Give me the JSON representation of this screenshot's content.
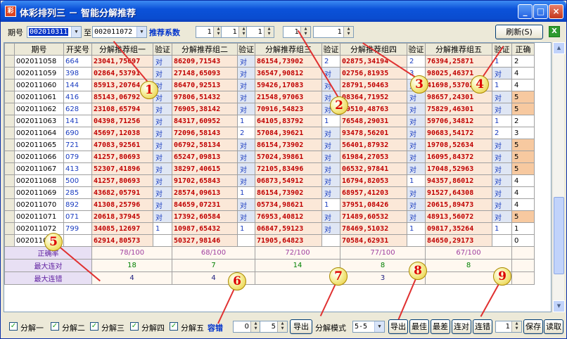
{
  "window": {
    "title": "体彩排列三 － 智能分解推荐",
    "icon": "pl3-app-icon",
    "buttons": [
      "minimize-icon",
      "maximize-icon",
      "close-icon"
    ]
  },
  "toolbar": {
    "period_label": "期号",
    "from_value": "002010311",
    "to_label": "至",
    "to_value": "002011072",
    "coef_label": "推荐系数",
    "coef_values": [
      "1",
      "1",
      "1",
      "1",
      "1"
    ],
    "refresh_label": "刷新(S)"
  },
  "table": {
    "headers": [
      "期号",
      "开奖号",
      "分解推荐组一",
      "验证",
      "分解推荐组二",
      "验证",
      "分解推荐组三",
      "验证",
      "分解推荐组四",
      "验证",
      "分解推荐组五",
      "验证",
      "正确"
    ],
    "rows": [
      [
        "002011058",
        "664",
        "23041,75697",
        "对",
        "86209,71543",
        "对",
        "86154,73902",
        "2",
        "02875,34194",
        "2",
        "76394,25871",
        "1",
        "2"
      ],
      [
        "002011059",
        "398",
        "02864,53791",
        "对",
        "27148,65093",
        "对",
        "36547,90812",
        "对",
        "02756,81935",
        "3",
        "98025,46371",
        "对",
        "4"
      ],
      [
        "002011060",
        "144",
        "85913,20764",
        "对",
        "86470,92513",
        "对",
        "59426,17083",
        "对",
        "28791,50463",
        "对",
        "41698,53702",
        "1",
        "4"
      ],
      [
        "002011061",
        "416",
        "85143,06792",
        "对",
        "97806,51432",
        "对",
        "21548,97063",
        "对",
        "08364,71952",
        "对",
        "98657,24301",
        "对",
        "5"
      ],
      [
        "002011062",
        "628",
        "23108,65794",
        "对",
        "76905,38142",
        "对",
        "70916,54823",
        "对",
        "29510,48763",
        "对",
        "75829,46301",
        "对",
        "5"
      ],
      [
        "002011063",
        "141",
        "04398,71256",
        "对",
        "84317,60952",
        "1",
        "64105,83792",
        "1",
        "76548,29031",
        "对",
        "59706,34812",
        "1",
        "2"
      ],
      [
        "002011064",
        "690",
        "45697,12038",
        "对",
        "72096,58143",
        "2",
        "57084,39621",
        "对",
        "93478,56201",
        "对",
        "90683,54172",
        "2",
        "3"
      ],
      [
        "002011065",
        "721",
        "47083,92561",
        "对",
        "06792,58134",
        "对",
        "86154,73902",
        "对",
        "56401,87932",
        "对",
        "19708,52634",
        "对",
        "5"
      ],
      [
        "002011066",
        "079",
        "41257,80693",
        "对",
        "65247,09813",
        "对",
        "57024,39861",
        "对",
        "61984,27053",
        "对",
        "16095,84372",
        "对",
        "5"
      ],
      [
        "002011067",
        "413",
        "52307,41896",
        "对",
        "38297,40615",
        "对",
        "72105,83496",
        "对",
        "06532,97841",
        "对",
        "17048,52963",
        "对",
        "5"
      ],
      [
        "002011068",
        "500",
        "41257,80693",
        "对",
        "91702,65843",
        "对",
        "06873,54912",
        "对",
        "16794,82053",
        "1",
        "94357,86012",
        "对",
        "4"
      ],
      [
        "002011069",
        "285",
        "43682,05791",
        "对",
        "28574,09613",
        "1",
        "86154,73902",
        "对",
        "68957,41203",
        "对",
        "91527,64308",
        "对",
        "4"
      ],
      [
        "002011070",
        "892",
        "41308,25796",
        "对",
        "84659,07231",
        "对",
        "05734,98621",
        "1",
        "37951,08426",
        "对",
        "20615,89473",
        "对",
        "4"
      ],
      [
        "002011071",
        "071",
        "20618,37945",
        "对",
        "17392,60584",
        "对",
        "76953,40812",
        "对",
        "71489,60532",
        "对",
        "48913,56072",
        "对",
        "5"
      ],
      [
        "002011072",
        "799",
        "34085,12697",
        "1",
        "10987,65432",
        "1",
        "06847,59123",
        "对",
        "78469,51032",
        "1",
        "09817,35264",
        "1",
        "1"
      ],
      [
        "002011073",
        "",
        "62914,80573",
        "",
        "50327,98146",
        "",
        "71905,64823",
        "",
        "70584,62931",
        "",
        "84650,29173",
        "",
        "0"
      ]
    ],
    "stats": {
      "labels": [
        "正确率",
        "最大连对",
        "最大连错"
      ],
      "accuracy": [
        "78/100",
        "68/100",
        "72/100",
        "77/100",
        "67/100"
      ],
      "max_correct": [
        "18",
        "7",
        "14",
        "8",
        "8"
      ],
      "max_wrong": [
        "4",
        "4",
        "",
        "3",
        ""
      ]
    }
  },
  "bottom": {
    "checks": [
      "分解一",
      "分解二",
      "分解三",
      "分解四",
      "分解五"
    ],
    "tolerance_label": "容错",
    "tol_from": "0",
    "tol_to": "5",
    "export_label": "导出",
    "mode_label": "分解模式",
    "mode_value": "5-5",
    "btn_export2": "导出",
    "btn_best": "最佳",
    "btn_worst": "最差",
    "btn_streak_right": "连对",
    "btn_streak_wrong": "连错",
    "count_value": "1",
    "btn_save": "保存",
    "btn_load": "读取"
  },
  "annotations": [
    "1",
    "2",
    "3",
    "4",
    "5",
    "6",
    "7",
    "8",
    "9"
  ]
}
